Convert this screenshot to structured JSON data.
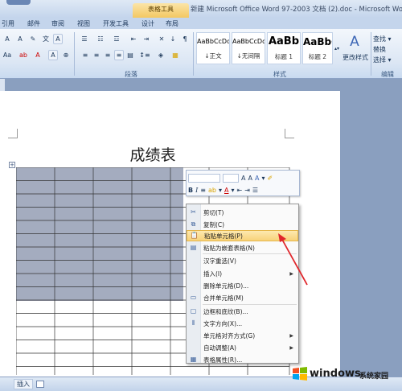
{
  "window": {
    "contextual_tab_group": "表格工具",
    "title": "新建 Microsoft Office Word 97-2003 文档 (2).doc - Microsoft Word"
  },
  "tabs": [
    "引用",
    "邮件",
    "审阅",
    "视图",
    "开发工具",
    "设计",
    "布局"
  ],
  "ribbon": {
    "paragraph_group": "段落",
    "styles_group": "样式",
    "edit_group": "编辑",
    "styles": [
      {
        "preview": "AaBbCcDd",
        "name": "↓正文"
      },
      {
        "preview": "AaBbCcDd",
        "name": "↓无间隔"
      },
      {
        "preview": "AaBb",
        "name": "标题 1"
      },
      {
        "preview": "AaBbC",
        "name": "标题 2"
      }
    ],
    "change_styles": "更改样式",
    "find": "查找 ▾",
    "replace": "替换",
    "select": "选择 ▾"
  },
  "document": {
    "title": "成绩表"
  },
  "mini_toolbar": {
    "row1": [
      "A",
      "A",
      "A",
      "▾"
    ],
    "row2": [
      "B",
      "I",
      "≡",
      "▾",
      "A",
      "▾"
    ]
  },
  "context_menu": {
    "items": [
      {
        "label": "剪切(T)",
        "icon": "scissors-icon",
        "submenu": false
      },
      {
        "label": "复制(C)",
        "icon": "copy-icon",
        "submenu": false
      },
      {
        "label": "粘贴单元格(P)",
        "icon": "paste-icon",
        "submenu": false,
        "highlighted": true
      },
      {
        "label": "粘贴为嵌套表格(N)",
        "icon": "paste-nested-icon",
        "submenu": false
      },
      {
        "label": "汉字重选(V)",
        "icon": "",
        "submenu": false
      },
      {
        "label": "插入(I)",
        "icon": "",
        "submenu": true
      },
      {
        "label": "删除单元格(D)...",
        "icon": "",
        "submenu": false
      },
      {
        "label": "合并单元格(M)",
        "icon": "merge-cells-icon",
        "submenu": false
      },
      {
        "label": "边框和底纹(B)...",
        "icon": "borders-icon",
        "submenu": false
      },
      {
        "label": "文字方向(X)...",
        "icon": "text-direction-icon",
        "submenu": false
      },
      {
        "label": "单元格对齐方式(G)",
        "icon": "",
        "submenu": true
      },
      {
        "label": "自动调整(A)",
        "icon": "",
        "submenu": true
      },
      {
        "label": "表格属性(R)...",
        "icon": "table-properties-icon",
        "submenu": false
      }
    ]
  },
  "status_bar": {
    "mode": "插入"
  },
  "watermark": {
    "brand": "windows",
    "brand_cn": "系统家园"
  },
  "colors": {
    "selection": "#a4acbf",
    "highlight": "#f8d27a",
    "arrow": "#e0262b",
    "ribbon": "#dbe6f4"
  }
}
